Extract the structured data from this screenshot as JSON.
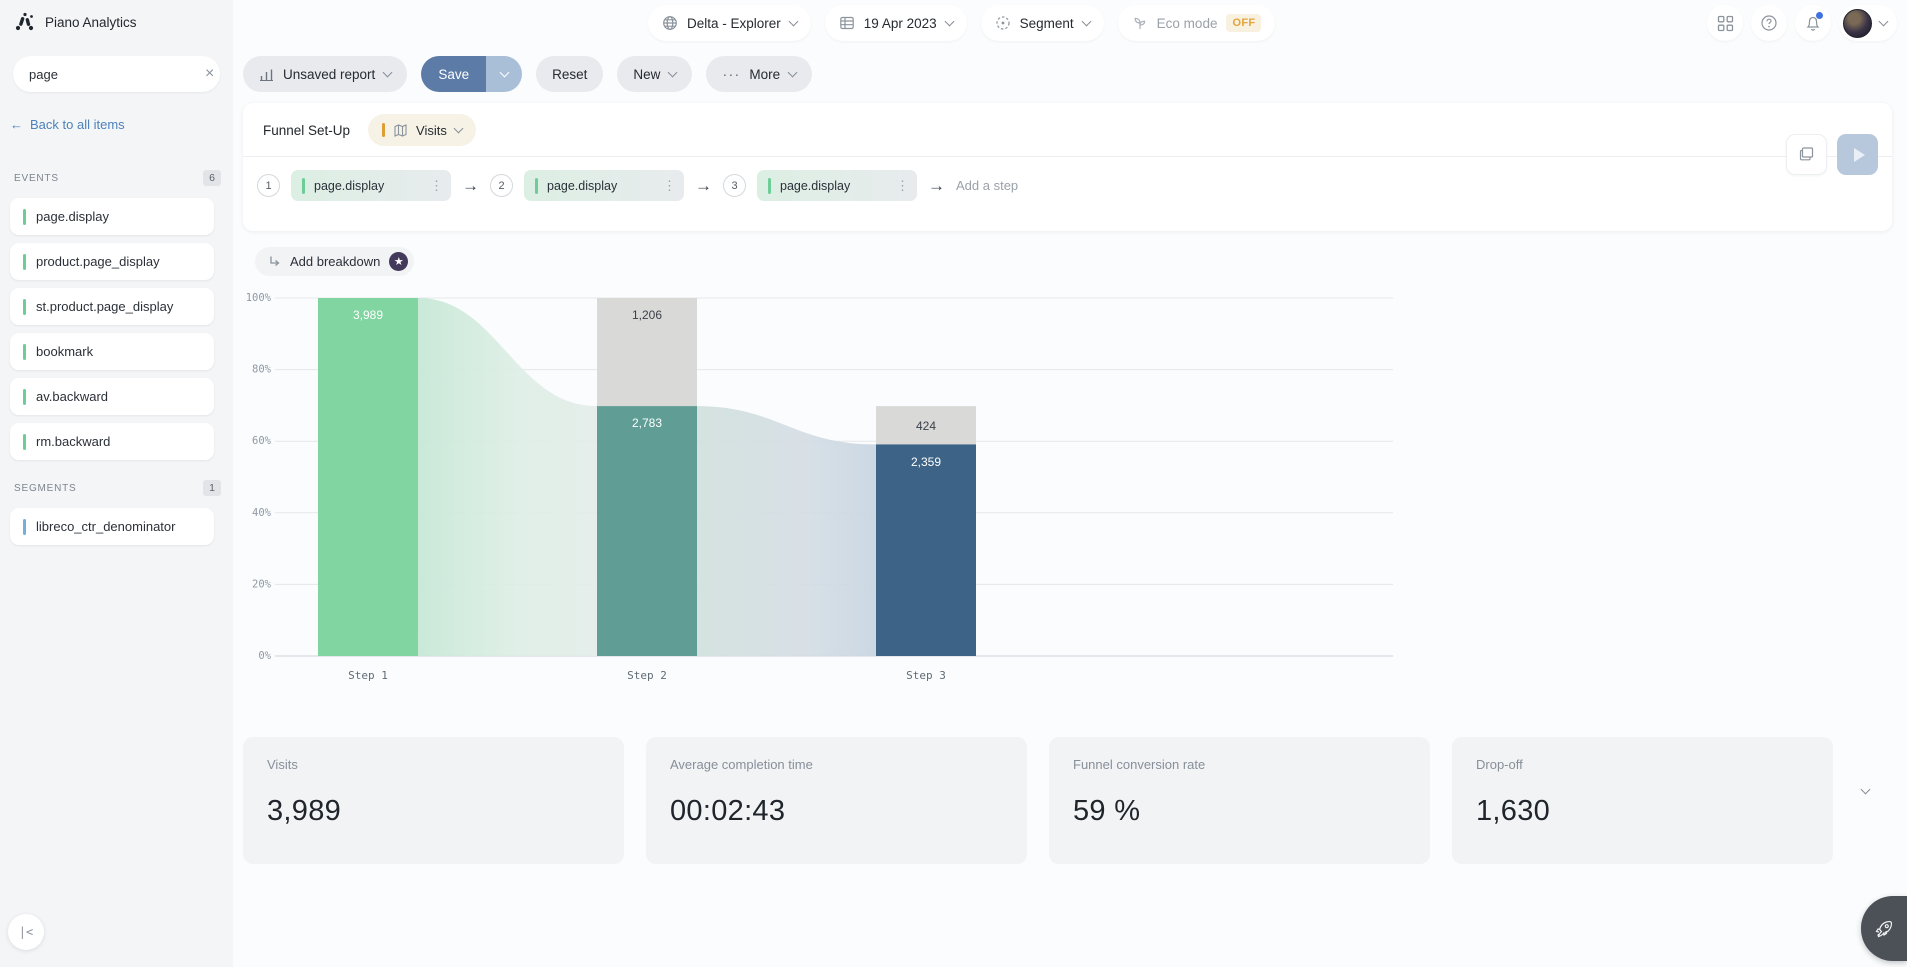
{
  "header": {
    "app_title": "Piano Analytics",
    "site_selector": "Delta - Explorer",
    "date_selector": "19 Apr 2023",
    "segment_selector": "Segment",
    "eco_mode_label": "Eco mode",
    "eco_mode_state": "OFF"
  },
  "sidebar": {
    "search_value": "page",
    "back_link": "Back to all items",
    "sections": [
      {
        "title": "EVENTS",
        "count": "6",
        "items": [
          "page.display",
          "product.page_display",
          "st.product.page_display",
          "bookmark",
          "av.backward",
          "rm.backward"
        ]
      },
      {
        "title": "SEGMENTS",
        "count": "1",
        "items": [
          "libreco_ctr_denominator"
        ]
      }
    ]
  },
  "toolbar": {
    "report_name": "Unsaved report",
    "save_label": "Save",
    "reset_label": "Reset",
    "new_label": "New",
    "more_label": "More"
  },
  "funnel_setup": {
    "title": "Funnel Set-Up",
    "metric": "Visits",
    "steps": [
      {
        "number": "1",
        "event": "page.display"
      },
      {
        "number": "2",
        "event": "page.display"
      },
      {
        "number": "3",
        "event": "page.display"
      }
    ],
    "add_step_label": "Add a step"
  },
  "breakdown": {
    "label": "Add breakdown"
  },
  "chart_data": {
    "type": "funnel",
    "metric": "Visits",
    "categories": [
      "Step 1",
      "Step 2",
      "Step 3"
    ],
    "values": [
      3989,
      2783,
      2359
    ],
    "value_labels": [
      "3,989",
      "2,783",
      "2,359"
    ],
    "drops": [
      0,
      1206,
      424
    ],
    "drop_labels": [
      "",
      "1,206",
      "424"
    ],
    "percent_of_first": [
      100,
      69.8,
      59.1
    ],
    "ylabel_ticks": [
      "100%",
      "80%",
      "60%",
      "40%",
      "20%",
      "0%"
    ],
    "ylim": [
      0,
      100
    ],
    "grid": true,
    "colors": {
      "step1": "#80d5a0",
      "step2": "#5f9d95",
      "step3": "#3d6387",
      "drop": "#d9dad8"
    }
  },
  "kpis": [
    {
      "label": "Visits",
      "value": "3,989"
    },
    {
      "label": "Average completion time",
      "value": "00:02:43"
    },
    {
      "label": "Funnel conversion rate",
      "value": "59 %"
    },
    {
      "label": "Drop-off",
      "value": "1,630"
    }
  ],
  "icons": {
    "back_arrow": "←",
    "close": "×",
    "kebab": "⋮",
    "arrow_right": "→",
    "star": "★",
    "more_dots": "···",
    "collapse": "|<"
  }
}
